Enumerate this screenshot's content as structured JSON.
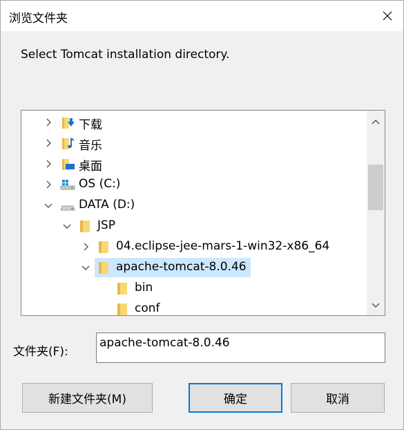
{
  "window": {
    "title": "浏览文件夹"
  },
  "prompt": "Select Tomcat installation directory.",
  "tree": {
    "items": [
      {
        "label": "下载",
        "icon": "downloads-folder-icon",
        "expanded": false,
        "selected": false
      },
      {
        "label": "音乐",
        "icon": "music-folder-icon",
        "expanded": false,
        "selected": false
      },
      {
        "label": "桌面",
        "icon": "desktop-folder-icon",
        "expanded": false,
        "selected": false
      },
      {
        "label": "OS (C:)",
        "icon": "windows-drive-icon",
        "expanded": false,
        "selected": false
      },
      {
        "label": "DATA (D:)",
        "icon": "drive-icon",
        "expanded": true,
        "selected": false
      },
      {
        "label": "JSP",
        "icon": "folder-icon",
        "expanded": true,
        "selected": false
      },
      {
        "label": "04.eclipse-jee-mars-1-win32-x86_64",
        "icon": "folder-icon",
        "expanded": false,
        "selected": false
      },
      {
        "label": "apache-tomcat-8.0.46",
        "icon": "folder-icon",
        "expanded": true,
        "selected": true
      },
      {
        "label": "bin",
        "icon": "folder-icon",
        "expanded": null,
        "selected": false
      },
      {
        "label": "conf",
        "icon": "folder-icon",
        "expanded": null,
        "selected": false
      }
    ]
  },
  "folder": {
    "label": "文件夹(F):",
    "value": "apache-tomcat-8.0.46"
  },
  "buttons": {
    "new_folder": "新建文件夹(M)",
    "ok": "确定",
    "cancel": "取消"
  },
  "colors": {
    "selection": "#cce8ff",
    "default_button_border": "#0078d7",
    "folder_yellow": "#f8d775"
  }
}
